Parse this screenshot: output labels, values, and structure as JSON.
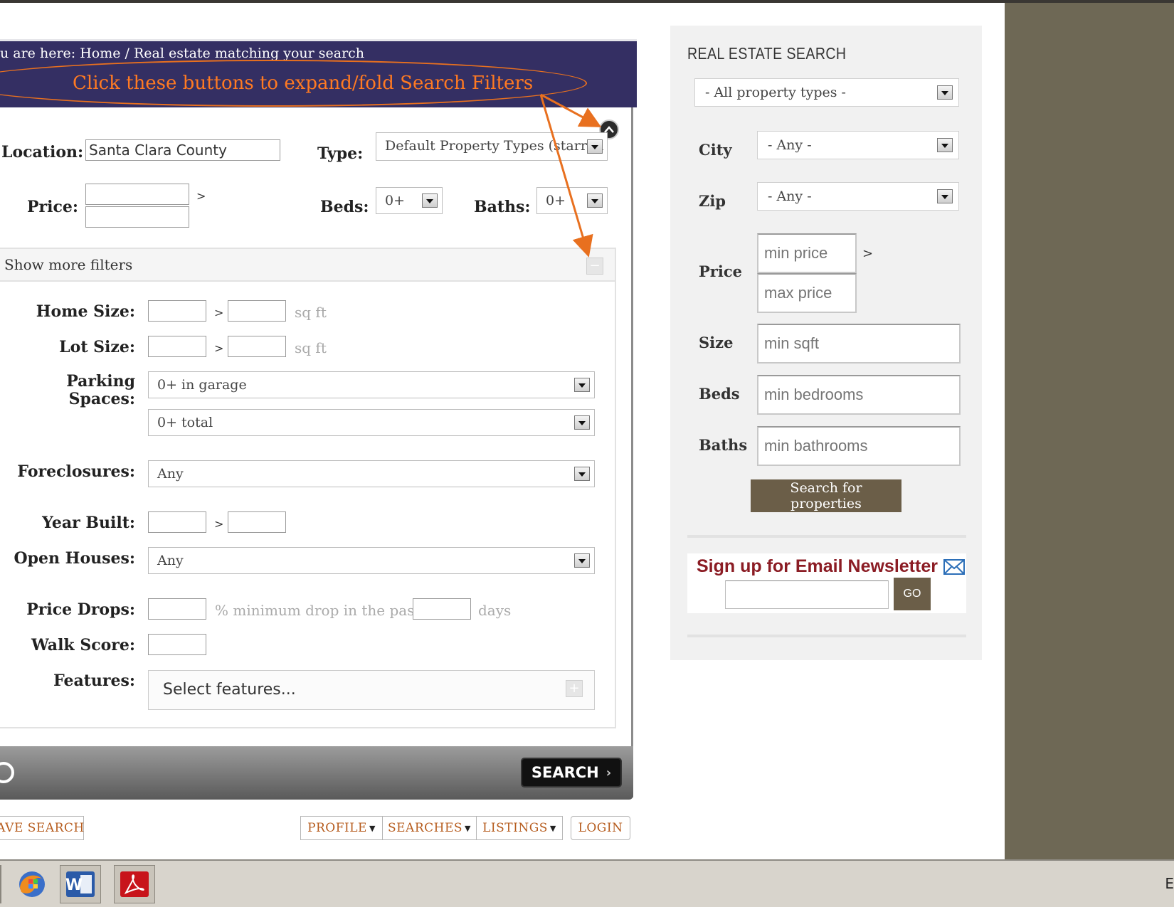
{
  "breadcrumb": {
    "text": "u are here: Home / Real estate matching your search"
  },
  "annotation": {
    "callout": "Click these buttons to expand/fold Search Filters",
    "color": "#e8701f"
  },
  "search_form": {
    "location_label": "Location:",
    "location_value": "Santa Clara County",
    "type_label": "Type:",
    "type_value": "Default Property Types (starred",
    "price_label": "Price:",
    "price_sep": ">",
    "beds_label": "Beds:",
    "beds_value": "0+",
    "baths_label": "Baths:",
    "baths_value": "0+"
  },
  "more_filters": {
    "header": "Show more filters",
    "collapse_symbol": "−",
    "home_size_label": "Home Size:",
    "lot_size_label": "Lot Size:",
    "size_sep": ">",
    "sqft_unit": "sq ft",
    "parking_label": "Parking Spaces:",
    "parking_garage_value": "0+ in garage",
    "parking_total_value": "0+ total",
    "foreclosures_label": "Foreclosures:",
    "foreclosures_value": "Any",
    "year_built_label": "Year Built:",
    "open_houses_label": "Open Houses:",
    "open_houses_value": "Any",
    "price_drops_label": "Price Drops:",
    "price_drops_mid": "% minimum drop in the past",
    "price_drops_unit": "days",
    "walk_score_label": "Walk Score:",
    "features_label": "Features:",
    "features_placeholder": "Select features...",
    "expand_symbol": "+"
  },
  "search_bar": {
    "search_label": "SEARCH",
    "chevron": "›"
  },
  "bottom_nav": {
    "save_search": "AVE SEARCH",
    "profile": "PROFILE",
    "searches": "SEARCHES",
    "listings": "LISTINGS",
    "login": "LOGIN",
    "caret": "▼"
  },
  "sidebar": {
    "title": "REAL ESTATE SEARCH",
    "property_types_value": "- All property types -",
    "city_label": "City",
    "city_value": "- Any -",
    "zip_label": "Zip",
    "zip_value": "- Any -",
    "price_label": "Price",
    "min_price_placeholder": "min price",
    "max_price_placeholder": "max price",
    "price_sep": ">",
    "size_label": "Size",
    "size_placeholder": "min sqft",
    "beds_label": "Beds",
    "beds_placeholder": "min bedrooms",
    "baths_label": "Baths",
    "baths_placeholder": "min bathrooms",
    "search_button": "Search for properties",
    "newsletter_title": "Sign up for Email Newsletter",
    "go_button": "GO",
    "accent_color": "#6b5e48",
    "newsletter_color": "#8b1c24"
  },
  "taskbar": {
    "word_letter": "W",
    "lang": "E",
    "icons": [
      "firefox-icon",
      "word-icon",
      "pdf-icon"
    ]
  },
  "colors": {
    "band": "#342f63",
    "page_bg": "#6e6855"
  }
}
